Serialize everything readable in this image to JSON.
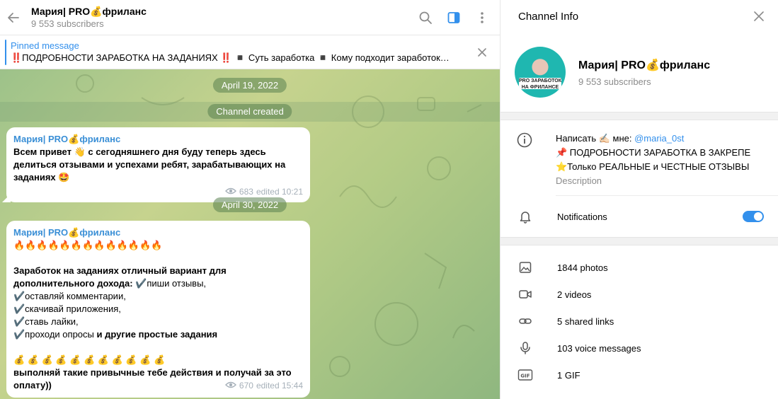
{
  "chat": {
    "title": "Мария| PRO💰фриланс",
    "subtitle": "9 553 subscribers",
    "pinned": {
      "label": "Pinned message",
      "text": "‼️ПОДРОБНОСТИ ЗАРАБОТКА  НА ЗАДАНИЯХ ‼️ ◾️ Суть заработка ◾️ Кому подходит заработок…"
    },
    "dates": [
      "April 19, 2022",
      "April 30, 2022"
    ],
    "service": "Channel created",
    "messages": [
      {
        "author": "Мария| PRO💰фриланс",
        "text": "Всем привет 👋 с сегодняшнего дня буду теперь здесь делиться отзывами и успехами ребят, зарабатывающих на заданиях 🤩",
        "views": "683",
        "time": "edited 10:21"
      },
      {
        "author": "Мария| PRO💰фриланс",
        "fire": "🔥🔥🔥🔥🔥🔥🔥🔥🔥🔥🔥🔥🔥",
        "intro": "Заработок на заданиях отличный вариант для дополнительного дохода:",
        "items": [
          "✔️пиши отзывы,",
          "✔️оставляй комментарии,",
          "✔️скачивай приложения,",
          "✔️ставь лайки,",
          "✔️проходи опросы"
        ],
        "last_bold": " и другие простые задания",
        "bags": "💰 💰 💰 💰 💰 💰 💰 💰 💰 💰 💰",
        "outro": "выполняй такие привычные тебе действия и получай за это оплату))",
        "views": "670",
        "time": "edited 15:44"
      }
    ]
  },
  "info": {
    "header": "Channel Info",
    "name": "Мария| PRO💰фриланс",
    "subscribers": "9 553 subscribers",
    "avatar_text": "PRO ЗАРАБОТОК НА ФРИЛАНСЕ",
    "description": {
      "line1_prefix": "Написать ✍🏻 мне: ",
      "line1_link": "@maria_0st",
      "line2": "📌 ПОДРОБНОСТИ ЗАРАБОТКА В ЗАКРЕПЕ",
      "line3": "⭐️Только РЕАЛЬНЫЕ и ЧЕСТНЫЕ ОТЗЫВЫ",
      "label": "Description"
    },
    "notifications_label": "Notifications",
    "notifications_on": true,
    "media": [
      {
        "icon": "photo-icon",
        "label": "1844 photos"
      },
      {
        "icon": "video-icon",
        "label": "2 videos"
      },
      {
        "icon": "link-icon",
        "label": "5 shared links"
      },
      {
        "icon": "microphone-icon",
        "label": "103 voice messages"
      },
      {
        "icon": "gif-icon",
        "label": "1 GIF"
      }
    ]
  },
  "colors": {
    "accent": "#3390ec",
    "author": "#3a8fd6"
  }
}
